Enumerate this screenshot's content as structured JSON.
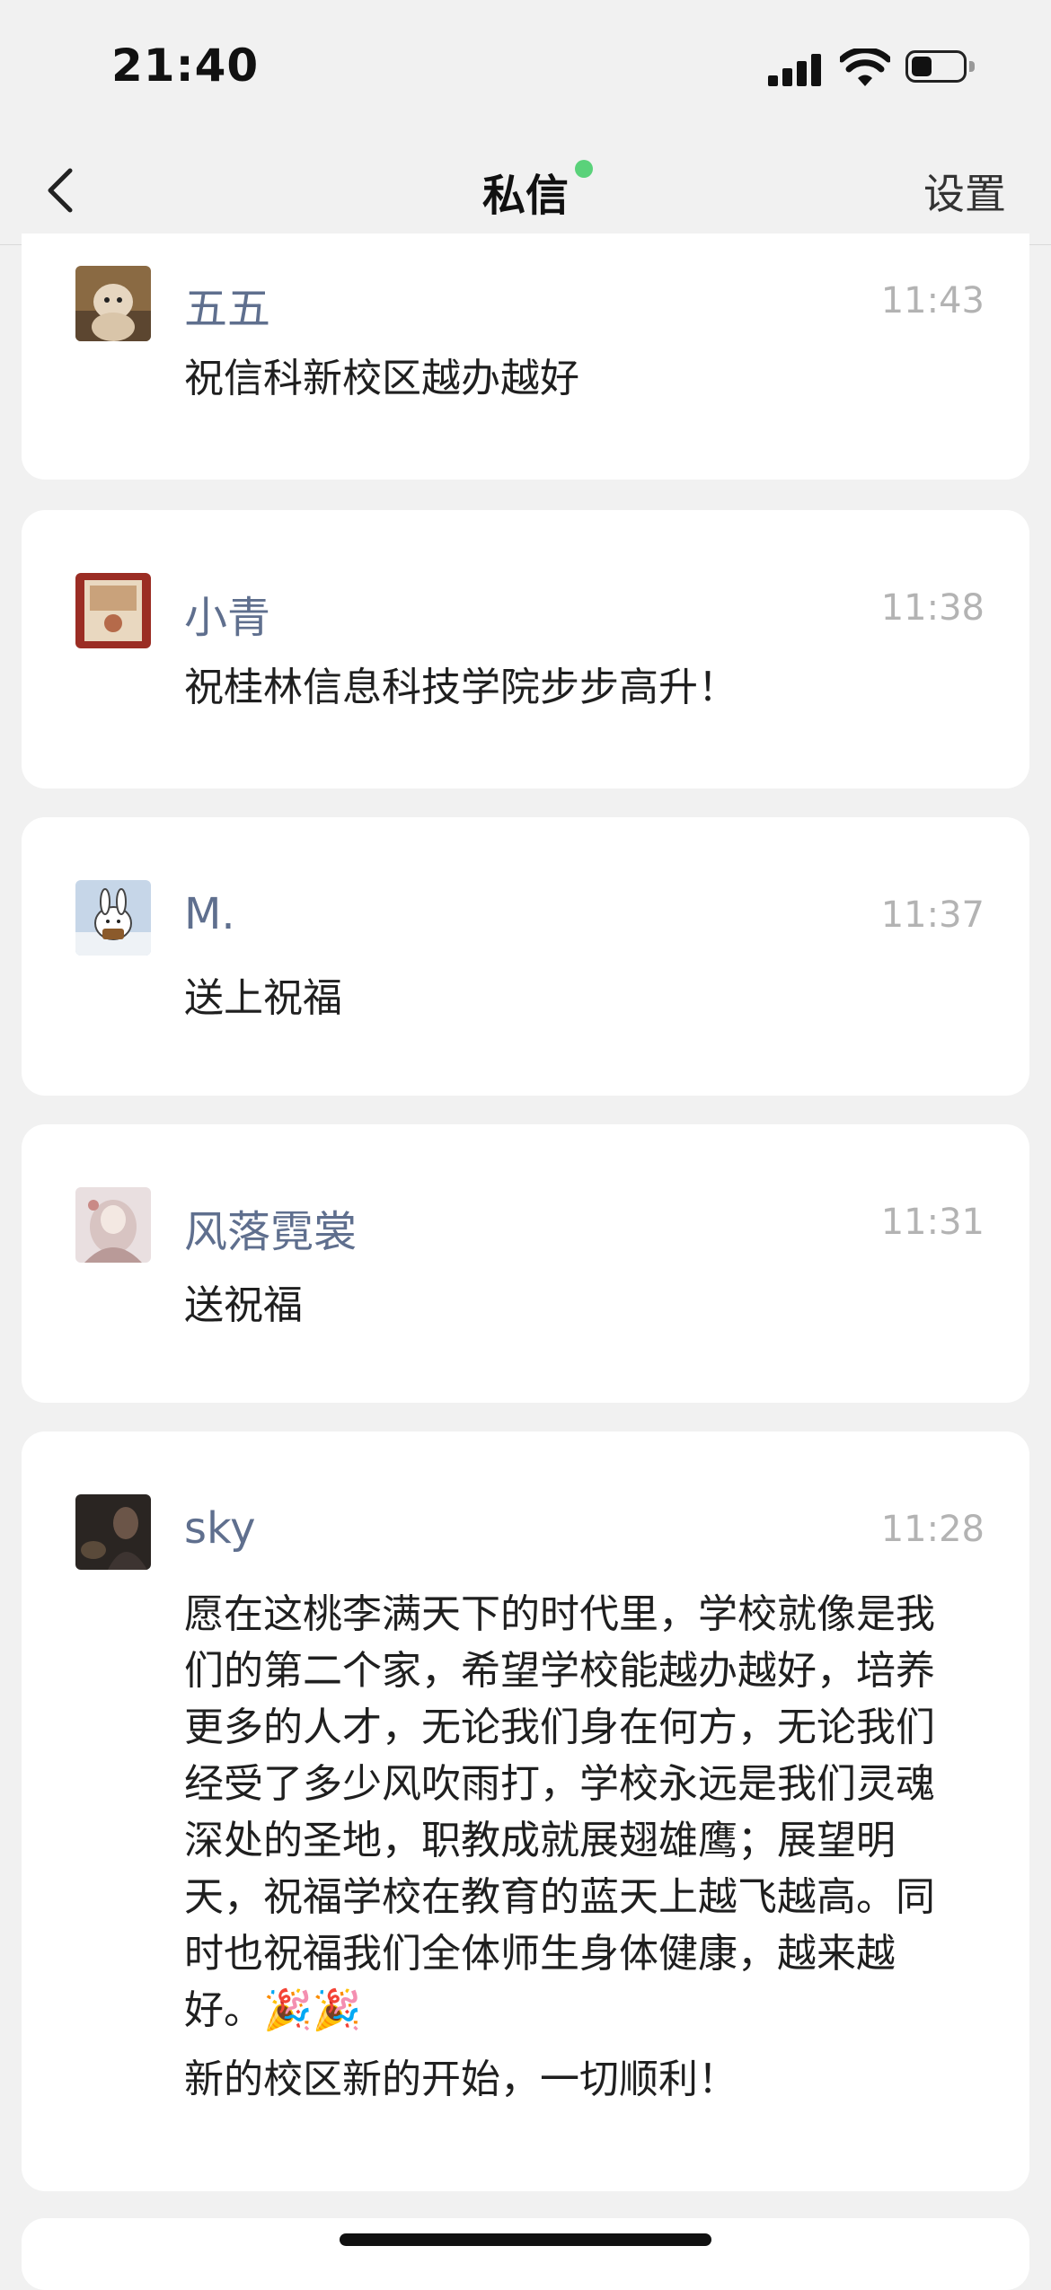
{
  "status_bar": {
    "time": "21:40"
  },
  "nav": {
    "title": "私信",
    "settings_label": "设置"
  },
  "messages": [
    {
      "sender": "五五",
      "time": "11:43",
      "avatar_icon": "avatar-photo-cat",
      "paragraphs": [
        "祝信科新校区越办越好"
      ]
    },
    {
      "sender": "小青",
      "time": "11:38",
      "avatar_icon": "avatar-photo-card",
      "paragraphs": [
        "祝桂林信息科技学院步步高升！"
      ]
    },
    {
      "sender": "M.",
      "time": "11:37",
      "avatar_icon": "avatar-cartoon-rabbit",
      "paragraphs": [
        "送上祝福"
      ]
    },
    {
      "sender": "风落霓裳",
      "time": "11:31",
      "avatar_icon": "avatar-illustration",
      "paragraphs": [
        "送祝福"
      ]
    },
    {
      "sender": "sky",
      "time": "11:28",
      "avatar_icon": "avatar-photo-person",
      "paragraphs": [
        "愿在这桃李满天下的时代里，学校就像是我们的第二个家，希望学校能越办越好，培养更多的人才，无论我们身在何方，无论我们经受了多少风吹雨打，学校永远是我们灵魂深处的圣地，职教成就展翅雄鹰；展望明天，祝福学校在教育的蓝天上越飞越高。同时也祝福我们全体师生身体健康，越来越好。🎉🎉",
        "新的校区新的开始，一切顺利！"
      ]
    }
  ],
  "colors": {
    "sender": "#5f6f8e",
    "time": "#b3b3b3",
    "online_dot": "#5ad27a",
    "background": "#f1f1f1"
  }
}
